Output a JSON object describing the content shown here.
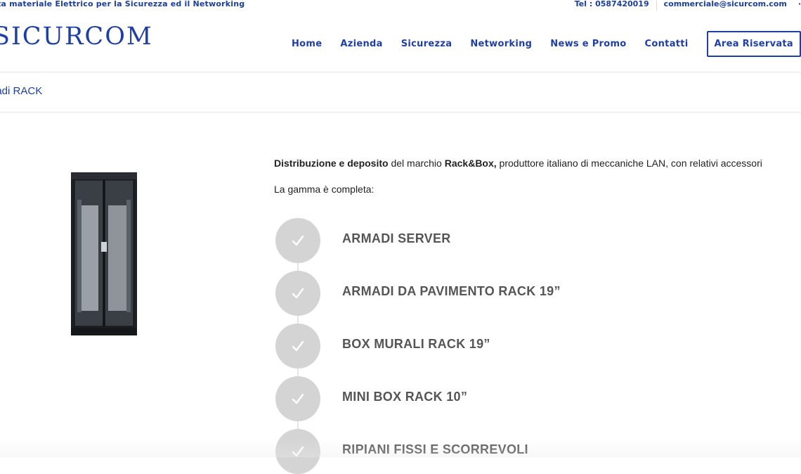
{
  "topbar": {
    "tagline": "ita materiale Elettrico per la Sicurezza ed il Networking",
    "phone": "Tel : 0587420019",
    "email": "commerciale@sicurcom.com",
    "tail": "·"
  },
  "header": {
    "logo": "SICURCOM",
    "nav": [
      {
        "label": "Home"
      },
      {
        "label": "Azienda"
      },
      {
        "label": "Sicurezza"
      },
      {
        "label": "Networking"
      },
      {
        "label": "News e Promo"
      },
      {
        "label": "Contatti"
      }
    ],
    "reserved_label": "Area Riservata"
  },
  "breadcrumb": {
    "title": "nadi RACK"
  },
  "content": {
    "intro_bold_1": "Distribuzione e deposito",
    "intro_text_1": " del marchio ",
    "intro_bold_2": "Rack&Box,",
    "intro_text_2": " produttore italiano di meccaniche LAN, con relativi accessori",
    "range_text": "La gamma è completa:",
    "items": [
      {
        "label": "ARMADI SERVER"
      },
      {
        "label": "ARMADI DA PAVIMENTO RACK 19”"
      },
      {
        "label": "BOX MURALI RACK 19”"
      },
      {
        "label": "MINI BOX RACK 10”"
      },
      {
        "label": "RIPIANI FISSI E SCORREVOLI"
      }
    ]
  },
  "colors": {
    "brand_blue": "#1f3fa6",
    "check_circle": "#d4d4d4"
  }
}
